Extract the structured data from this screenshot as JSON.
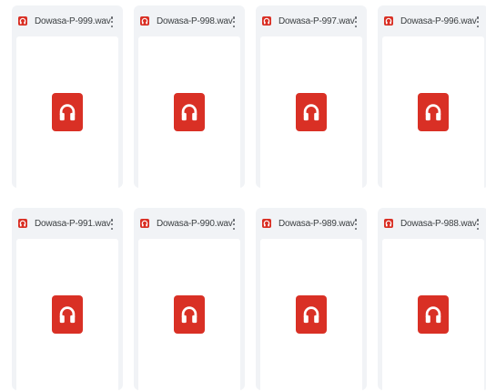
{
  "colors": {
    "audio_icon": "#d93025",
    "card_background": "#f1f3f6",
    "preview_background": "#ffffff",
    "file_name_text": "#3c4043"
  },
  "files": [
    {
      "name": "Dowasa-P-999.wav",
      "type_icon": "headphones-icon",
      "menu_icon": "more-vert-icon"
    },
    {
      "name": "Dowasa-P-998.wav",
      "type_icon": "headphones-icon",
      "menu_icon": "more-vert-icon"
    },
    {
      "name": "Dowasa-P-997.wav",
      "type_icon": "headphones-icon",
      "menu_icon": "more-vert-icon"
    },
    {
      "name": "Dowasa-P-996.wav",
      "type_icon": "headphones-icon",
      "menu_icon": "more-vert-icon"
    },
    {
      "name": "Dowasa-P-991.wav",
      "type_icon": "headphones-icon",
      "menu_icon": "more-vert-icon"
    },
    {
      "name": "Dowasa-P-990.wav",
      "type_icon": "headphones-icon",
      "menu_icon": "more-vert-icon"
    },
    {
      "name": "Dowasa-P-989.wav",
      "type_icon": "headphones-icon",
      "menu_icon": "more-vert-icon"
    },
    {
      "name": "Dowasa-P-988.wav",
      "type_icon": "headphones-icon",
      "menu_icon": "more-vert-icon"
    }
  ]
}
